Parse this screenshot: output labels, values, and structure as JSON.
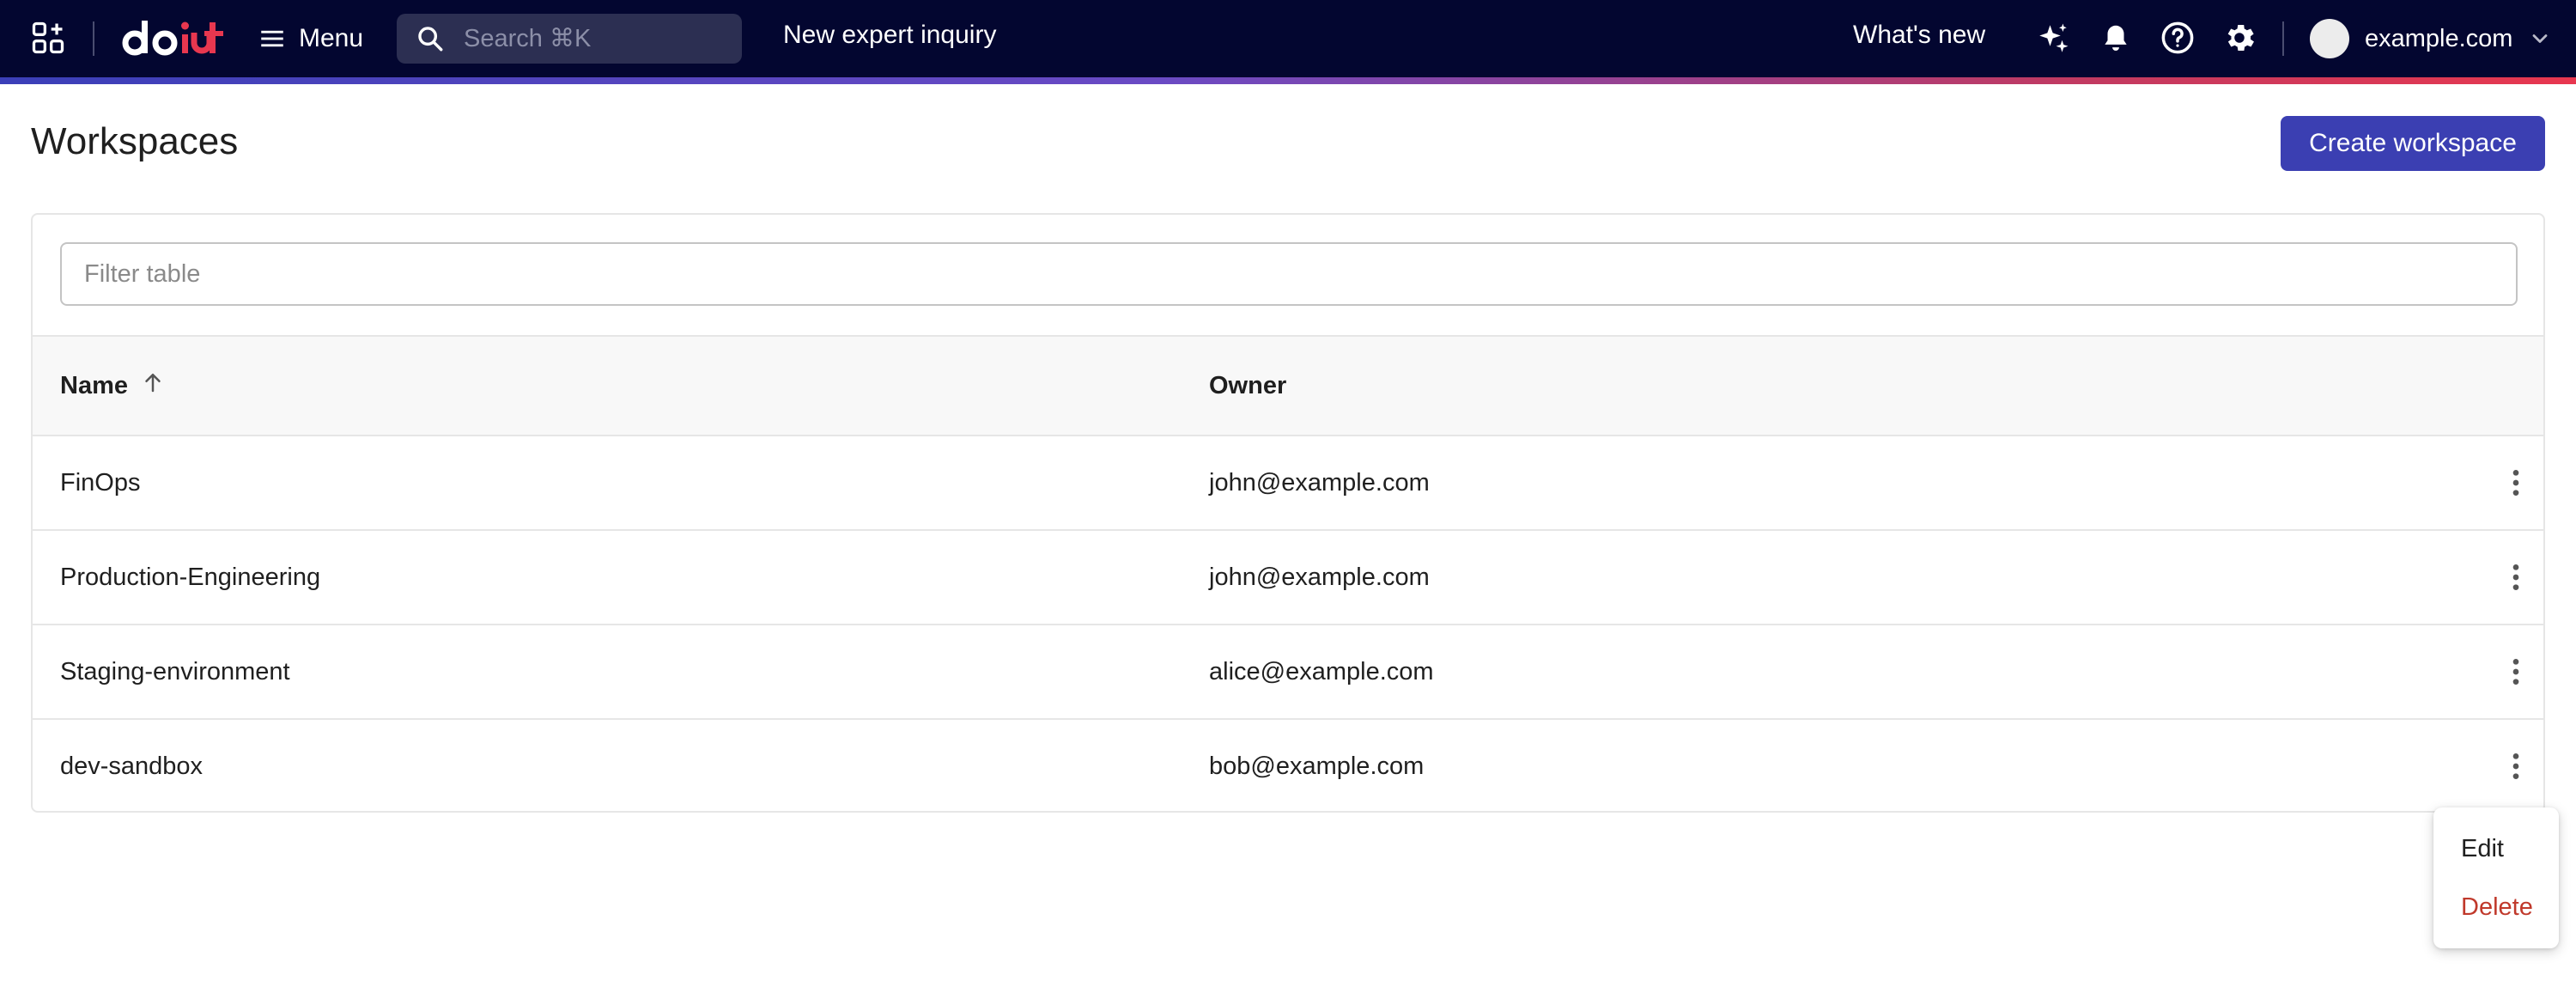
{
  "topbar": {
    "menu_label": "Menu",
    "search_placeholder": "Search ⌘K",
    "inquiry_label": "New expert inquiry",
    "whats_new_label": "What's new",
    "account_label": "example.com"
  },
  "page": {
    "title": "Workspaces",
    "create_button_label": "Create workspace"
  },
  "table": {
    "filter_placeholder": "Filter table",
    "columns": [
      {
        "label": "Name",
        "sort": "ascending"
      },
      {
        "label": "Owner"
      }
    ],
    "rows": [
      {
        "name": "FinOps",
        "owner": "john@example.com"
      },
      {
        "name": "Production-Engineering",
        "owner": "john@example.com"
      },
      {
        "name": "Staging-environment",
        "owner": "alice@example.com"
      },
      {
        "name": "dev-sandbox",
        "owner": "bob@example.com"
      }
    ]
  },
  "context_menu": {
    "items": [
      {
        "label": "Edit"
      },
      {
        "label": "Delete"
      }
    ]
  },
  "colors": {
    "topbar_bg": "#030630",
    "primary_button": "#3b3fb2",
    "delete_text": "#c0392b"
  },
  "icons": [
    "apps-icon",
    "doit-logo",
    "hamburger-icon",
    "search-icon",
    "sparkle-icon",
    "bell-icon",
    "help-icon",
    "gear-icon",
    "chevron-down-icon",
    "sort-arrow-up-icon",
    "more-vertical-icon"
  ]
}
